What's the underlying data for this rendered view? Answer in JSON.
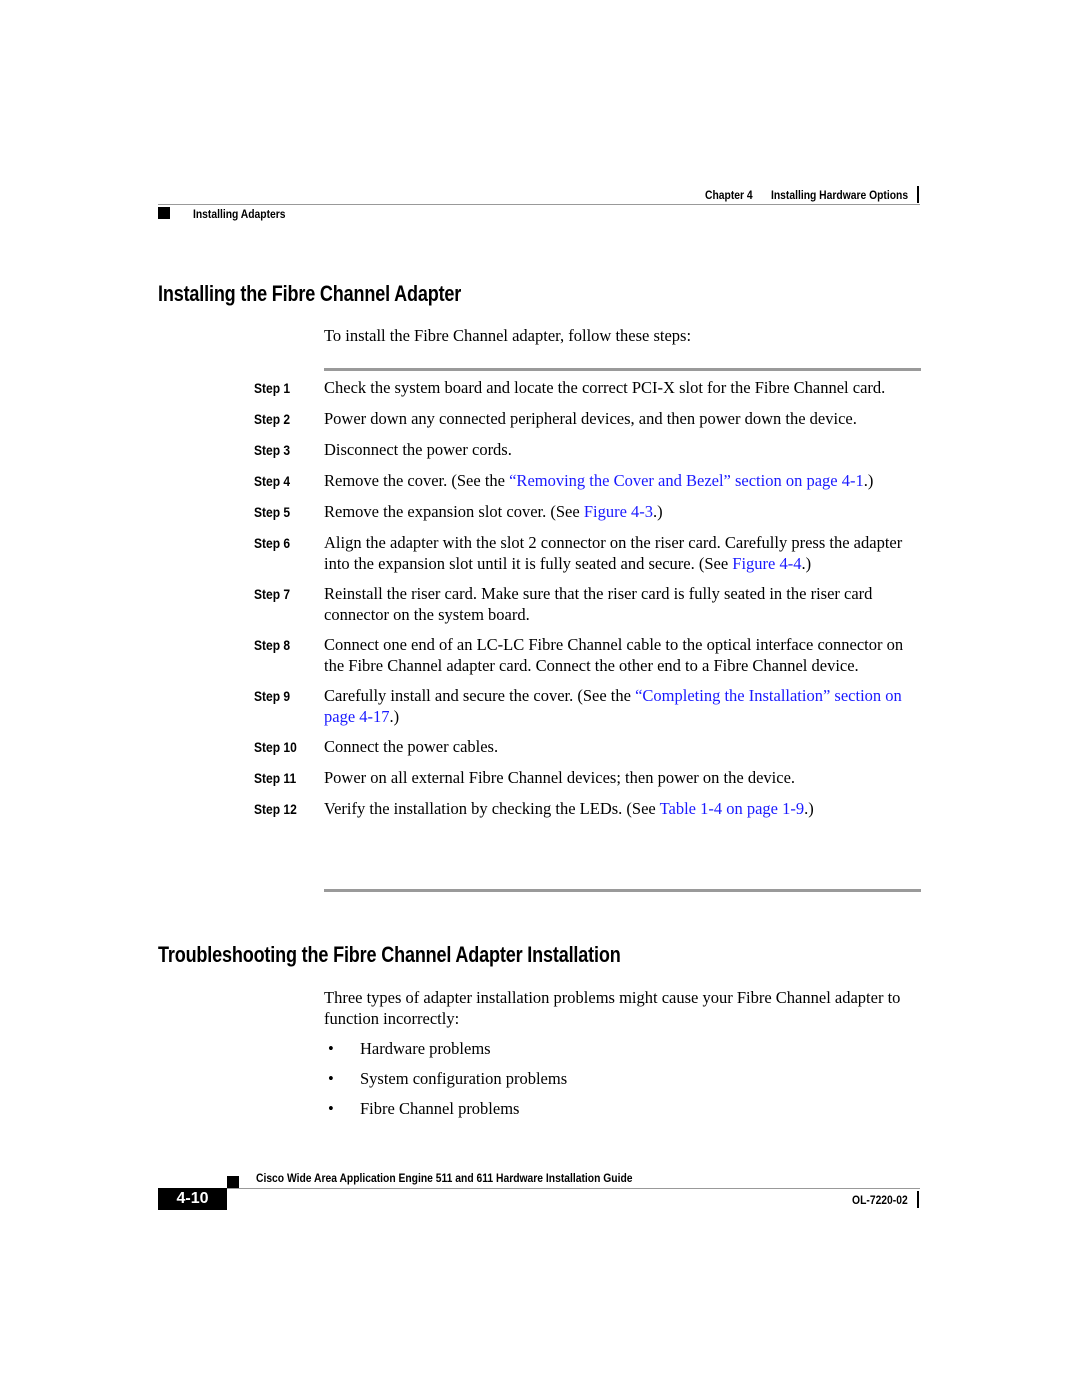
{
  "header": {
    "chapter": "Chapter 4",
    "chapter_title": "Installing Hardware Options",
    "section": "Installing Adapters"
  },
  "section1": {
    "title": "Installing the Fibre Channel Adapter",
    "intro": "To install the Fibre Channel adapter, follow these steps:",
    "steps": [
      {
        "label": "Step 1",
        "text": "Check the system board and locate the correct PCI-X slot for the Fibre Channel card."
      },
      {
        "label": "Step 2",
        "text": "Power down any connected peripheral devices, and then power down the device."
      },
      {
        "label": "Step 3",
        "text": "Disconnect the power cords."
      },
      {
        "label": "Step 4",
        "pre": "Remove the cover. (See the ",
        "link": "“Removing the Cover and Bezel” section on page 4-1",
        "post": ".)"
      },
      {
        "label": "Step 5",
        "pre": "Remove the expansion slot cover. (See ",
        "link": "Figure 4-3",
        "post": ".)"
      },
      {
        "label": "Step 6",
        "pre": "Align the adapter with the slot 2 connector on the riser card. Carefully press the adapter into the expansion slot until it is fully seated and secure. (See ",
        "link": "Figure 4-4",
        "post": ".)"
      },
      {
        "label": "Step 7",
        "text": "Reinstall the riser card. Make sure that the riser card is fully seated in the riser card connector on the system board."
      },
      {
        "label": "Step 8",
        "text": "Connect one end of an LC-LC Fibre Channel cable to the optical interface connector on the Fibre Channel adapter card. Connect the other end to a Fibre Channel device."
      },
      {
        "label": "Step 9",
        "pre": "Carefully install and secure the cover. (See the ",
        "link": "“Completing the Installation” section on page 4-17",
        "post": ".)"
      },
      {
        "label": "Step 10",
        "text": "Connect the power cables."
      },
      {
        "label": "Step 11",
        "text": "Power on all external Fibre Channel devices; then power on the device."
      },
      {
        "label": "Step 12",
        "pre": "Verify the installation by checking the LEDs. (See ",
        "link": "Table 1-4 on page 1-9",
        "post": ".)"
      }
    ]
  },
  "section2": {
    "title": "Troubleshooting the Fibre Channel Adapter Installation",
    "intro": "Three types of adapter installation problems might cause your Fibre Channel adapter to function incorrectly:",
    "bullet_glyph": "•",
    "bullets": [
      "Hardware problems",
      "System configuration problems",
      "Fibre Channel problems"
    ]
  },
  "footer": {
    "guide_title": "Cisco Wide Area Application Engine 511 and 611 Hardware Installation Guide",
    "page_number": "4-10",
    "doc_id": "OL-7220-02"
  },
  "colors": {
    "link": "#1a1aff",
    "rule": "#9a9a9a",
    "text": "#000000"
  }
}
